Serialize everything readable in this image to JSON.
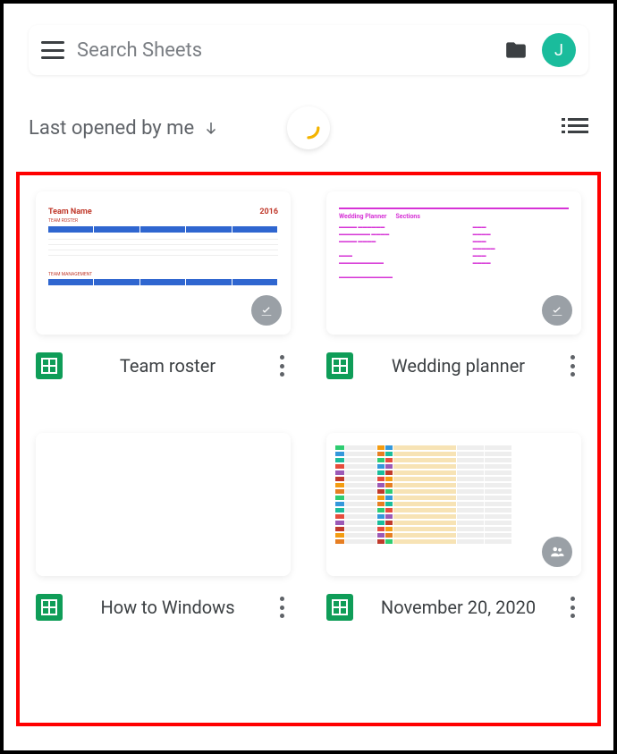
{
  "header": {
    "search_placeholder": "Search Sheets",
    "avatar_initial": "J"
  },
  "sort": {
    "label": "Last opened by me"
  },
  "files": [
    {
      "title": "Team roster",
      "badge": "offline-check",
      "thumb_type": "roster",
      "thumb_title": "Team Name",
      "thumb_year": "2016",
      "thumb_sub": "TEAM ROSTER",
      "thumb_foot": "TEAM MANAGEMENT"
    },
    {
      "title": "Wedding planner",
      "badge": "offline-check",
      "thumb_type": "wedding",
      "thumb_h1": "Wedding Planner",
      "thumb_h2": "Sections"
    },
    {
      "title": "How to Windows",
      "badge": null,
      "thumb_type": "blank"
    },
    {
      "title": "November 20, 2020",
      "badge": "shared",
      "thumb_type": "colored-table"
    }
  ],
  "colors": {
    "accent": "#1abc9c",
    "sheets_green": "#0f9d58",
    "spinner": "#f4b400",
    "highlight_border": "#ff0000"
  }
}
